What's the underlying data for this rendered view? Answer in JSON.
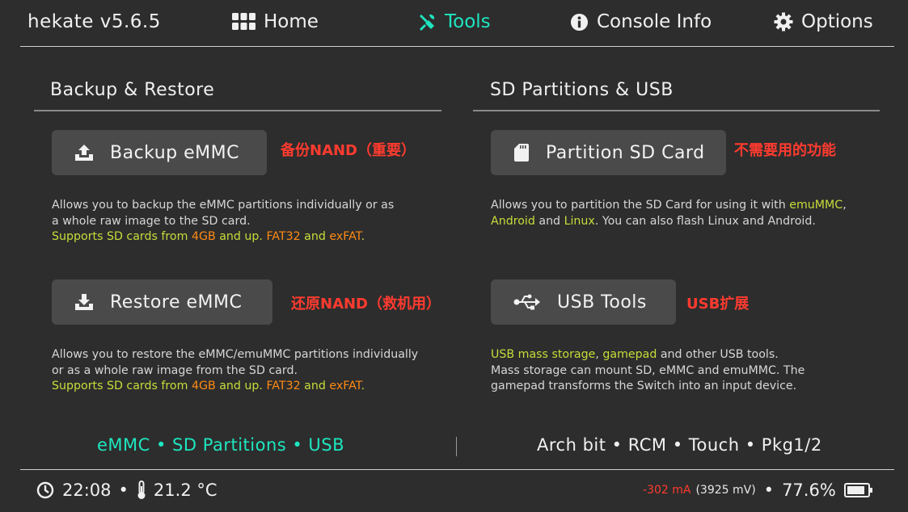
{
  "header": {
    "app_title": "hekate v5.6.5",
    "tabs": [
      {
        "label": "Home",
        "icon": "grid-icon"
      },
      {
        "label": "Tools",
        "icon": "tools-icon",
        "active": true
      },
      {
        "label": "Console Info",
        "icon": "info-icon"
      },
      {
        "label": "Options",
        "icon": "gear-icon"
      }
    ]
  },
  "colors": {
    "accent": "#1ee6c0",
    "annotation": "#ff3b2f",
    "highlight_yellow": "#c8dc3a",
    "highlight_orange": "#ff8a14"
  },
  "backup_restore": {
    "title": "Backup & Restore",
    "backup": {
      "label": "Backup eMMC",
      "note": "备份NAND（重要）",
      "desc1": "Allows you to backup the eMMC partitions individually or as",
      "desc2": "a whole raw image to the SD card.",
      "sup_a": "Supports SD cards from ",
      "sup_b": "4GB",
      "sup_c": " and up. ",
      "sup_d": "FAT32",
      "sup_e": " and ",
      "sup_f": "exFAT",
      "sup_g": "."
    },
    "restore": {
      "label": "Restore eMMC",
      "note": "还原NAND（救机用）",
      "desc1": "Allows you to restore the eMMC/emuMMC partitions individually",
      "desc2": "or as a whole raw image from the SD card.",
      "sup_a": "Supports SD cards from ",
      "sup_b": "4GB",
      "sup_c": " and up. ",
      "sup_d": "FAT32",
      "sup_e": " and ",
      "sup_f": "exFAT",
      "sup_g": "."
    }
  },
  "sd_usb": {
    "title": "SD Partitions & USB",
    "partition": {
      "label": "Partition SD Card",
      "note": "不需要用的功能",
      "d1a": "Allows you to partition the SD Card for using it with ",
      "d1b": "emuMMC",
      "d1c": ",",
      "d2a": "Android",
      "d2b": " and ",
      "d2c": "Linux",
      "d2d": ". You can also flash Linux and Android."
    },
    "usb": {
      "label": "USB Tools",
      "note": "USB扩展",
      "d1a": "USB mass storage",
      "d1b": ", ",
      "d1c": "gamepad",
      "d1d": " and other USB tools.",
      "d2": "Mass storage can mount SD, eMMC and emuMMC. The",
      "d3": "gamepad transforms the Switch into an input device."
    }
  },
  "footer": {
    "left": "eMMC • SD Partitions • USB",
    "right": "Arch bit • RCM • Touch • Pkg1/2"
  },
  "status": {
    "time": "22:08",
    "sep": "•",
    "temp": "21.2 °C",
    "current": "-302 mA",
    "voltage": "(3925 mV)",
    "battery": "77.6%"
  }
}
